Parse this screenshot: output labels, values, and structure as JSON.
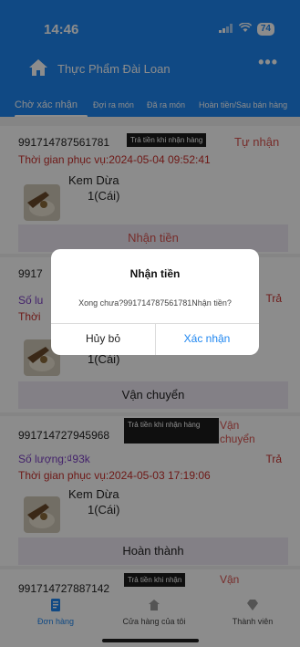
{
  "status_bar": {
    "time": "14:46",
    "battery": "74"
  },
  "app_bar": {
    "title": "Thực Phẩm Đài Loan",
    "more": "•••"
  },
  "tabs": [
    {
      "label": "Chờ xác nhận"
    },
    {
      "label": "Đợi ra món"
    },
    {
      "label": "Đã ra món"
    },
    {
      "label": "Hoàn tiền/Sau bán hàng"
    }
  ],
  "orders": [
    {
      "id": "991714787561781",
      "pay_tag": "Trả tiền khi nhận hàng",
      "delivery": "Tự nhận",
      "time": "Thời gian phục vụ:2024-05-04 09:52:41",
      "product": "Kem Dừa",
      "product_qty": "1(Cái)",
      "action": "Nhận tiền"
    },
    {
      "id_partial": "9917",
      "qty_partial": "Số lu",
      "time_partial": "Thời",
      "right_status": "Trả",
      "product_qty": "1(Cái)",
      "action": "Vận chuyển"
    },
    {
      "id": "991714727945968",
      "pay_tag": "Trả tiền khi nhận hàng",
      "delivery": "Vận chuyển",
      "qty_label": "Số lượng:₫93k",
      "right_status": "Trả",
      "time": "Thời gian phục vụ:2024-05-03 17:19:06",
      "product": "Kem Dừa",
      "product_qty": "1(Cái)",
      "action": "Hoàn thành"
    },
    {
      "id": "991714727887142",
      "pay_tag": "Trả tiền khi nhận",
      "delivery": "Vận"
    }
  ],
  "dialog": {
    "title": "Nhận tiền",
    "message": "Xong chưa?991714787561781Nhận tiền?",
    "cancel": "Hủy bỏ",
    "confirm": "Xác nhận"
  },
  "bottom_nav": [
    {
      "label": "Đơn hàng",
      "icon": "orders-icon"
    },
    {
      "label": "Cửa hàng của tôi",
      "icon": "store-icon"
    },
    {
      "label": "Thành viên",
      "icon": "member-icon"
    }
  ],
  "colors": {
    "primary": "#1e86f0",
    "accent_red": "#d9534f",
    "purple": "#7b3fc4"
  }
}
